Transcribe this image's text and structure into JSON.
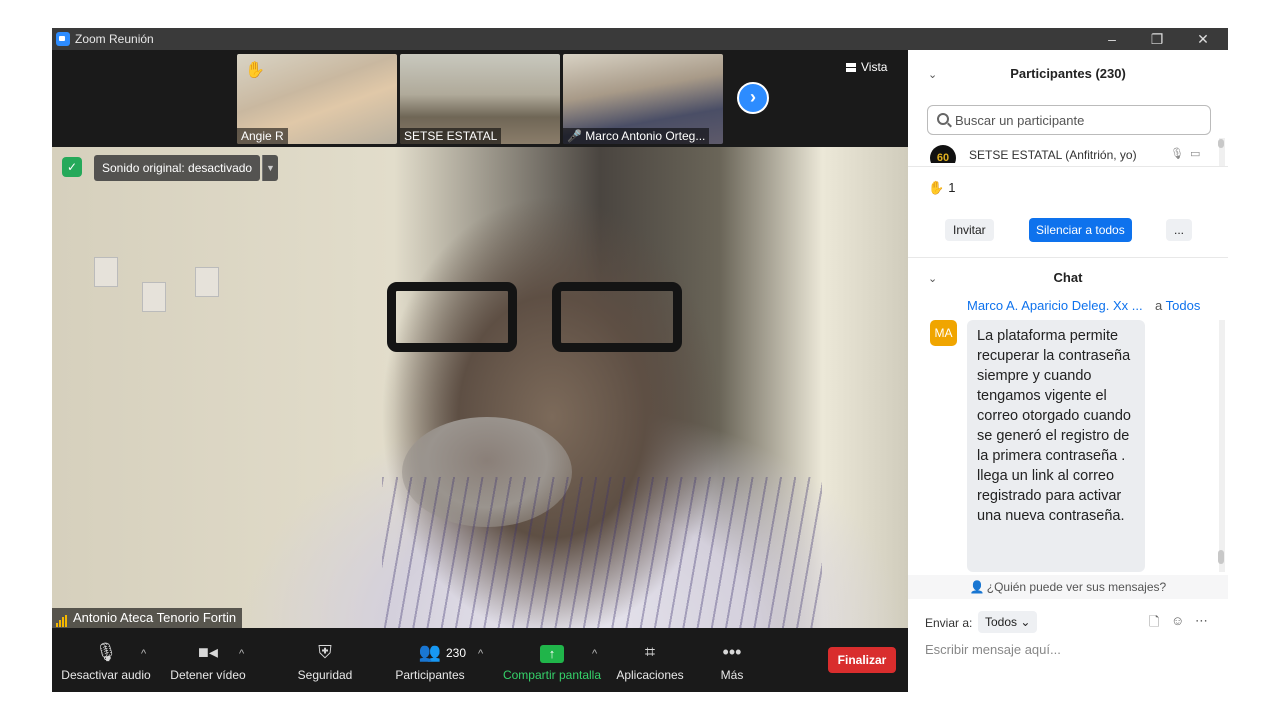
{
  "window": {
    "title": "Zoom Reunión",
    "controls": {
      "minimize": "–",
      "restore": "❐",
      "close": "✕"
    }
  },
  "gallery": {
    "thumbnails": [
      {
        "name": "Angie R",
        "badge": "hand-raised"
      },
      {
        "name": "SETSE ESTATAL",
        "badge": ""
      },
      {
        "name": "Marco Antonio Orteg...",
        "badge": "mic-muted"
      }
    ],
    "next_arrow": "›",
    "view_label": "Vista"
  },
  "speaker": {
    "name": "Antonio Ateca Tenorio Fortin",
    "original_sound": "Sonido original: desactivado",
    "security_icon": "shield-check-icon"
  },
  "toolbar": {
    "mute_label": "Desactivar audio",
    "video_label": "Detener vídeo",
    "security_label": "Seguridad",
    "participants_label": "Participantes",
    "participants_count": "230",
    "share_label": "Compartir pantalla",
    "apps_label": "Aplicaciones",
    "more_label": "Más",
    "end_label": "Finalizar",
    "colors": {
      "share": "#20b54a",
      "end": "#d92d2d"
    }
  },
  "participants_panel": {
    "title": "Participantes (230)",
    "search_placeholder": "Buscar un participante",
    "first_participant": {
      "avatar": "60",
      "name": "SETSE ESTATAL (Anfitrión, yo)"
    },
    "raised_hands": "1",
    "invite_label": "Invitar",
    "mute_all_label": "Silenciar a todos",
    "more_label": "..."
  },
  "chat_panel": {
    "title": "Chat",
    "message": {
      "sender": "Marco A. Aparicio Deleg. Xx ...",
      "to_prefix": "a",
      "to": "Todos",
      "avatar": "MA",
      "text": "La plataforma permite recuperar la contraseña siempre y cuando tengamos vigente el correo otorgado cuando se generó el registro de la primera contraseña . llega un link al correo registrado para activar una nueva contraseña."
    },
    "who_can_see": "¿Quién puede ver sus mensajes?",
    "send_to_label": "Enviar a:",
    "send_to_value": "Todos",
    "input_placeholder": "Escribir mensaje aquí..."
  },
  "colors": {
    "accent": "#0e72ed",
    "avatar_orange": "#f0a500"
  }
}
